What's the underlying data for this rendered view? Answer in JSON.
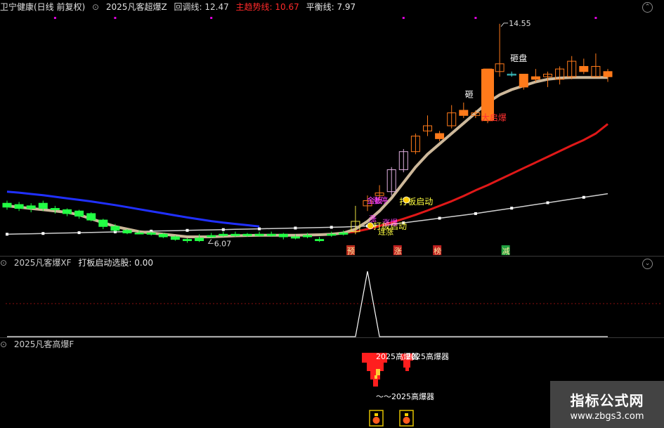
{
  "main_header": {
    "stock": "卫宁健康(日线 前复权)",
    "indicator": "2025凡客超爆Z",
    "pullback": "回调线: 12.47",
    "trend": "主趋势线: 10.67",
    "balance": "平衡线: 7.97"
  },
  "main_labels": {
    "high": "14.55",
    "low": "6.07",
    "zaPan1": "砸盘",
    "zaPan2": "砸",
    "daQiBao": "大启爆",
    "daBan1": "打板启动",
    "daBan2": "打板启动",
    "jinBan": "金板",
    "zhangTing": "涨停",
    "zhangBao": "涨爆",
    "zhangBan": "涨",
    "lianZhang": "连涨"
  },
  "bottom_markers": [
    "预",
    "涨",
    "榜",
    "减"
  ],
  "xf_header": {
    "name": "2025凡客爆XF",
    "value": "打板启动选股: 0.00"
  },
  "f_header": {
    "name": "2025凡客高爆F"
  },
  "f_labels": {
    "a": "2025高爆器",
    "b": "2025高爆器",
    "c": "～～2025高爆器"
  },
  "watermark": {
    "title": "指标公式网",
    "url": "www.zbgs3.com"
  },
  "chart_data": {
    "type": "candlestick",
    "candles": [
      {
        "o": 7.45,
        "c": 7.6,
        "h": 7.7,
        "l": 7.35
      },
      {
        "o": 7.55,
        "c": 7.4,
        "h": 7.65,
        "l": 7.3
      },
      {
        "o": 7.4,
        "c": 7.5,
        "h": 7.6,
        "l": 7.25
      },
      {
        "o": 7.6,
        "c": 7.4,
        "h": 7.7,
        "l": 7.3
      },
      {
        "o": 7.4,
        "c": 7.35,
        "h": 7.5,
        "l": 7.2
      },
      {
        "o": 7.35,
        "c": 7.2,
        "h": 7.4,
        "l": 7.1
      },
      {
        "o": 7.3,
        "c": 7.1,
        "h": 7.35,
        "l": 7.0
      },
      {
        "o": 7.2,
        "c": 6.95,
        "h": 7.25,
        "l": 6.9
      },
      {
        "o": 6.95,
        "c": 6.7,
        "h": 7.0,
        "l": 6.6
      },
      {
        "o": 6.7,
        "c": 6.55,
        "h": 6.8,
        "l": 6.5
      },
      {
        "o": 6.55,
        "c": 6.45,
        "h": 6.6,
        "l": 6.4
      },
      {
        "o": 6.45,
        "c": 6.45,
        "h": 6.55,
        "l": 6.4
      },
      {
        "o": 6.45,
        "c": 6.4,
        "h": 6.5,
        "l": 6.35
      },
      {
        "o": 6.4,
        "c": 6.3,
        "h": 6.45,
        "l": 6.25
      },
      {
        "o": 6.3,
        "c": 6.2,
        "h": 6.35,
        "l": 6.15
      },
      {
        "o": 6.2,
        "c": 6.15,
        "h": 6.25,
        "l": 6.07
      },
      {
        "o": 6.15,
        "c": 6.25,
        "h": 6.4,
        "l": 6.1
      },
      {
        "o": 6.3,
        "c": 6.35,
        "h": 6.45,
        "l": 6.25
      },
      {
        "o": 6.35,
        "c": 6.4,
        "h": 6.5,
        "l": 6.3
      },
      {
        "o": 6.4,
        "c": 6.35,
        "h": 6.5,
        "l": 6.3
      },
      {
        "o": 6.35,
        "c": 6.4,
        "h": 6.45,
        "l": 6.3
      },
      {
        "o": 6.4,
        "c": 6.35,
        "h": 6.5,
        "l": 6.3
      },
      {
        "o": 6.35,
        "c": 6.4,
        "h": 6.5,
        "l": 6.3
      },
      {
        "o": 6.4,
        "c": 6.3,
        "h": 6.45,
        "l": 6.2
      },
      {
        "o": 6.3,
        "c": 6.25,
        "h": 6.4,
        "l": 6.2
      },
      {
        "o": 6.3,
        "c": 6.35,
        "h": 6.45,
        "l": 6.25
      },
      {
        "o": 6.2,
        "c": 6.15,
        "h": 6.3,
        "l": 6.1
      },
      {
        "o": 6.4,
        "c": 6.4,
        "h": 6.5,
        "l": 6.3
      },
      {
        "o": 6.4,
        "c": 6.45,
        "h": 6.55,
        "l": 6.35
      },
      {
        "o": 6.5,
        "c": 6.9,
        "h": 7.5,
        "l": 6.4
      },
      {
        "o": 7.5,
        "c": 7.7,
        "h": 7.9,
        "l": 7.3
      },
      {
        "o": 7.9,
        "c": 8.0,
        "h": 8.3,
        "l": 7.7
      },
      {
        "o": 8.05,
        "c": 8.9,
        "h": 9.0,
        "l": 7.9
      },
      {
        "o": 8.9,
        "c": 9.6,
        "h": 9.7,
        "l": 8.8
      },
      {
        "o": 9.6,
        "c": 10.2,
        "h": 10.3,
        "l": 9.5
      },
      {
        "o": 10.4,
        "c": 10.6,
        "h": 11.0,
        "l": 10.2
      },
      {
        "o": 10.3,
        "c": 10.1,
        "h": 10.4,
        "l": 10.0
      },
      {
        "o": 10.6,
        "c": 11.1,
        "h": 11.4,
        "l": 10.5
      },
      {
        "o": 11.2,
        "c": 11.0,
        "h": 11.5,
        "l": 10.9
      },
      {
        "o": 11.0,
        "c": 11.1,
        "h": 11.2,
        "l": 10.9
      },
      {
        "o": 10.8,
        "c": 12.8,
        "h": 12.8,
        "l": 10.7
      },
      {
        "o": 12.7,
        "c": 13.0,
        "h": 14.55,
        "l": 12.5
      },
      {
        "o": 12.6,
        "c": 12.6,
        "h": 12.7,
        "l": 12.5
      },
      {
        "o": 12.6,
        "c": 12.1,
        "h": 12.6,
        "l": 12.0
      },
      {
        "o": 12.5,
        "c": 12.4,
        "h": 12.8,
        "l": 12.3
      },
      {
        "o": 12.5,
        "c": 12.6,
        "h": 12.7,
        "l": 12.1
      },
      {
        "o": 12.4,
        "c": 12.8,
        "h": 12.9,
        "l": 12.2
      },
      {
        "o": 12.5,
        "c": 13.1,
        "h": 13.3,
        "l": 12.4
      },
      {
        "o": 12.9,
        "c": 12.7,
        "h": 13.2,
        "l": 12.6
      },
      {
        "o": 12.5,
        "c": 12.9,
        "h": 13.4,
        "l": 12.5
      },
      {
        "o": 12.7,
        "c": 12.5,
        "h": 12.8,
        "l": 12.3
      }
    ],
    "pullback_line": [
      7.5,
      7.45,
      7.4,
      7.35,
      7.3,
      7.25,
      7.15,
      7.0,
      6.85,
      6.7,
      6.6,
      6.5,
      6.45,
      6.4,
      6.35,
      6.3,
      6.3,
      6.3,
      6.32,
      6.34,
      6.35,
      6.36,
      6.36,
      6.36,
      6.36,
      6.37,
      6.38,
      6.4,
      6.45,
      6.6,
      6.9,
      7.3,
      7.8,
      8.4,
      9.0,
      9.5,
      9.9,
      10.3,
      10.7,
      11.1,
      11.5,
      11.8,
      12.0,
      12.15,
      12.3,
      12.4,
      12.45,
      12.47,
      12.47,
      12.47,
      12.47
    ],
    "trend_line": [
      7.5,
      7.48,
      7.45,
      7.42,
      7.38,
      7.34,
      7.3,
      7.26,
      7.21,
      7.16,
      7.1,
      7.04,
      6.98,
      6.92,
      6.86,
      6.8,
      6.75,
      6.7,
      6.66,
      6.63,
      6.6,
      6.57,
      6.55,
      6.52,
      6.5,
      6.48,
      6.46,
      6.45,
      6.45,
      6.5,
      6.6,
      6.72,
      6.85,
      7.0,
      7.15,
      7.32,
      7.5,
      7.68,
      7.88,
      8.1,
      8.3,
      8.52,
      8.74,
      8.96,
      9.18,
      9.4,
      9.62,
      9.84,
      10.05,
      10.3,
      10.67
    ],
    "balance_line": [
      6.4,
      6.41,
      6.42,
      6.43,
      6.44,
      6.45,
      6.46,
      6.47,
      6.48,
      6.49,
      6.5,
      6.51,
      6.52,
      6.53,
      6.54,
      6.55,
      6.56,
      6.57,
      6.58,
      6.59,
      6.6,
      6.61,
      6.62,
      6.63,
      6.64,
      6.65,
      6.66,
      6.67,
      6.68,
      6.7,
      6.72,
      6.75,
      6.79,
      6.84,
      6.9,
      6.96,
      7.02,
      7.08,
      7.14,
      7.2,
      7.27,
      7.34,
      7.41,
      7.48,
      7.55,
      7.62,
      7.69,
      7.76,
      7.83,
      7.9,
      7.97
    ],
    "xf_signal": [
      0,
      0,
      0,
      0,
      0,
      0,
      0,
      0,
      0,
      0,
      0,
      0,
      0,
      0,
      0,
      0,
      0,
      0,
      0,
      0,
      0,
      0,
      0,
      0,
      0,
      0,
      0,
      0,
      0,
      0,
      1,
      0,
      0,
      0,
      0,
      0,
      0,
      0,
      0,
      0,
      0,
      0,
      0,
      0,
      0,
      0,
      0,
      0,
      0,
      0,
      0
    ]
  }
}
